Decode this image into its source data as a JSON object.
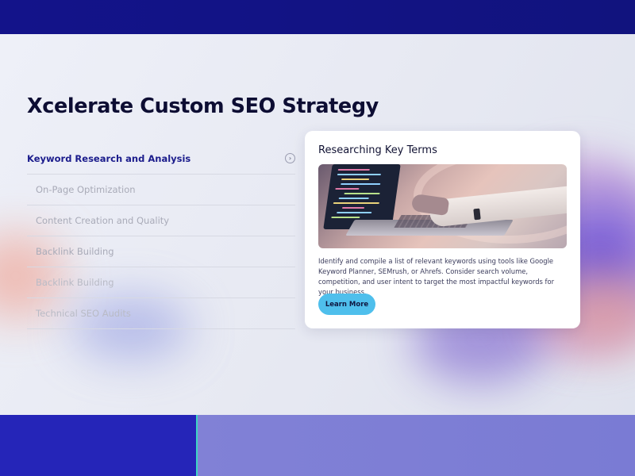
{
  "hero": {
    "title": "Xcelerate Custom SEO Strategy"
  },
  "menu": {
    "items": [
      {
        "label": "Keyword Research and Analysis",
        "state": "active"
      },
      {
        "label": "On-Page Optimization",
        "state": "inactive"
      },
      {
        "label": "Content Creation and Quality",
        "state": "inactive"
      },
      {
        "label": "Backlink Building",
        "state": "inactive"
      },
      {
        "label": "Backlink Building",
        "state": "inactive"
      },
      {
        "label": "Technical SEO Audits",
        "state": "inactive"
      }
    ],
    "active_icon": "chevron-right-circle-icon"
  },
  "card": {
    "title": "Researching Key Terms",
    "image_description": "laptop-typing-image",
    "body": "Identify and compile a list of relevant keywords using tools like Google Keyword Planner, SEMrush, or Ahrefs. Consider search volume, competition, and user intent to target the most impactful keywords for your business.",
    "button_label": "Learn More"
  },
  "colors": {
    "header_band": "#13138a",
    "active_menu": "#1b1c8c",
    "button": "#4fbfec",
    "bottom_left": "#2525b8",
    "bottom_accent": "#3dd6c4",
    "bottom_right": "#7f80d5"
  }
}
